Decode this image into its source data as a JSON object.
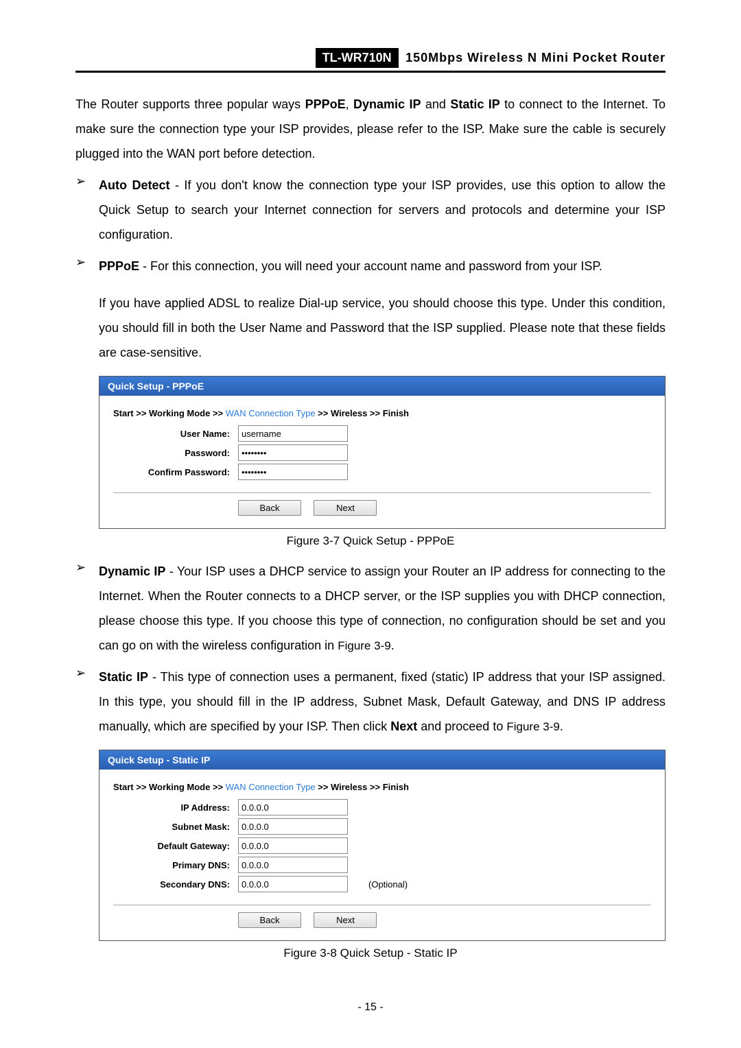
{
  "header": {
    "model": "TL-WR710N",
    "desc": "150Mbps Wireless N Mini Pocket Router"
  },
  "intro": {
    "pre": "The Router supports three popular ways ",
    "b1": "PPPoE",
    "sep1": ", ",
    "b2": "Dynamic IP",
    "sep2": " and ",
    "b3": "Static IP",
    "post": " to connect to the Internet. To make sure the connection type your ISP provides, please refer to the ISP. Make sure the cable is securely plugged into the WAN port before detection."
  },
  "bullets": {
    "arrow": "➢",
    "auto": {
      "title": "Auto Detect",
      "dash": " - ",
      "text": "If you don't know the connection type your ISP provides, use this option to allow the Quick Setup to search your Internet connection for servers and protocols and determine your ISP configuration."
    },
    "pppoe": {
      "title": "PPPoE",
      "dash": " - ",
      "line1": "For this connection, you will need your account name and password from your ISP.",
      "line2": "If you have applied ADSL to realize Dial-up service, you should choose this type. Under this condition, you should fill in both the User Name and Password that the ISP supplied. Please note that these fields are case-sensitive."
    },
    "dyn": {
      "title": "Dynamic IP",
      "dash": " - ",
      "text": "Your ISP uses a DHCP service to assign your Router an IP address for connecting to the Internet. When the Router connects to a DHCP server, or the ISP supplies you with DHCP connection, please choose this type. If you choose this type of connection, no configuration should be set and you can go on with the wireless configuration in ",
      "ref": "Figure 3-9",
      "end": "."
    },
    "static": {
      "title": "Static IP",
      "dash": " - ",
      "text1": "This type of connection uses a permanent, fixed (static) IP address that your ISP assigned. In this type, you should fill in the IP address, Subnet Mask, Default Gateway, and DNS IP address manually, which are specified by your ISP. Then click ",
      "next": "Next",
      "text2": " and proceed to ",
      "ref": "Figure 3-9",
      "end": "."
    }
  },
  "fig1": {
    "title": "Quick Setup - PPPoE",
    "breadcrumb": {
      "p1": "Start >> Working Mode >> ",
      "active": "WAN Connection Type",
      "p2": " >> Wireless >> Finish"
    },
    "rows": {
      "user_label": "User Name:",
      "user_value": "username",
      "pass_label": "Password:",
      "pass_value": "••••••••",
      "conf_label": "Confirm Password:",
      "conf_value": "••••••••"
    },
    "back": "Back",
    "next": "Next",
    "caption": "Figure 3-7   Quick Setup - PPPoE"
  },
  "fig2": {
    "title": "Quick Setup - Static IP",
    "breadcrumb": {
      "p1": "Start >> Working Mode >> ",
      "active": "WAN Connection Type",
      "p2": " >> Wireless >> Finish"
    },
    "rows": {
      "ip_label": "IP Address:",
      "ip_value": "0.0.0.0",
      "mask_label": "Subnet Mask:",
      "mask_value": "0.0.0.0",
      "gw_label": "Default Gateway:",
      "gw_value": "0.0.0.0",
      "pdns_label": "Primary DNS:",
      "pdns_value": "0.0.0.0",
      "sdns_label": "Secondary DNS:",
      "sdns_value": "0.0.0.0",
      "optional": "(Optional)"
    },
    "back": "Back",
    "next": "Next",
    "caption": "Figure 3-8   Quick Setup - Static IP"
  },
  "page_number": "- 15 -"
}
